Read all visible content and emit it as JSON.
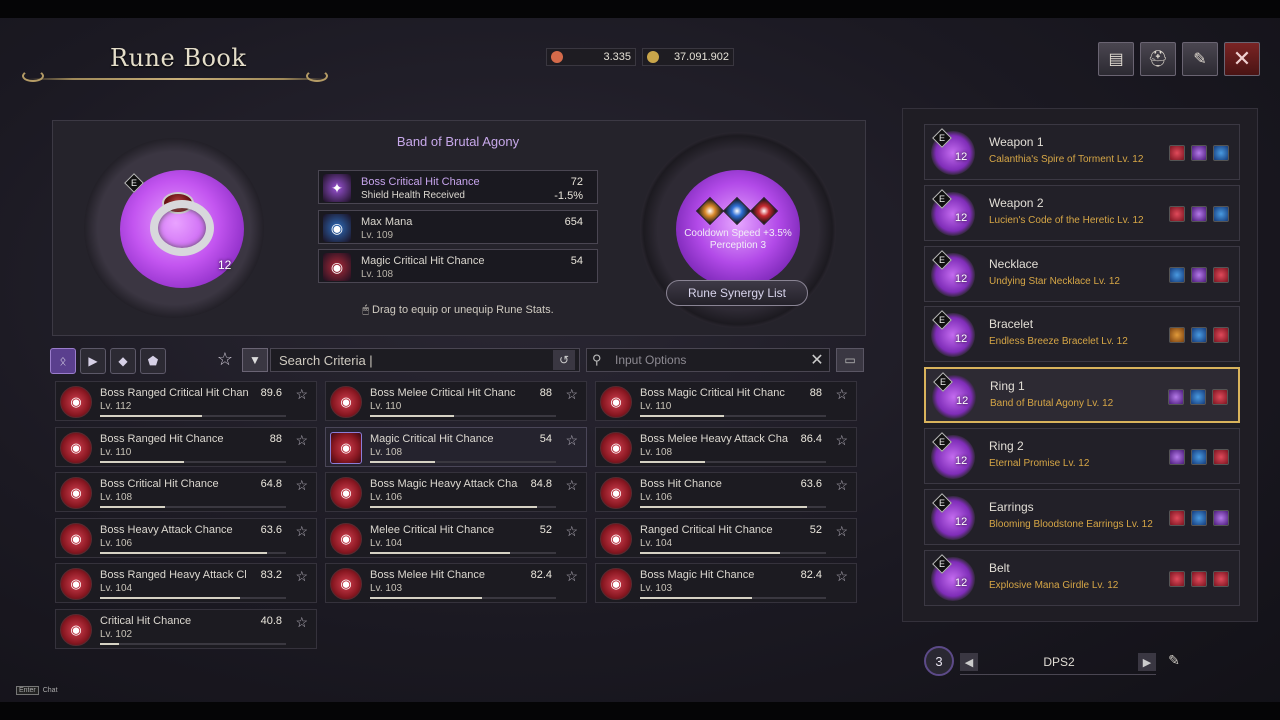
{
  "title": "Rune Book",
  "currency": [
    {
      "value": "3.335",
      "icon": "quill-icon",
      "color": "#d46a4a"
    },
    {
      "value": "37.091.902",
      "icon": "gold-coin-icon",
      "color": "#c9a54a"
    }
  ],
  "top_buttons": [
    {
      "name": "card-icon",
      "glyph": "▤"
    },
    {
      "name": "helmet-icon",
      "glyph": "⛑"
    },
    {
      "name": "scroll-icon",
      "glyph": "✎"
    },
    {
      "name": "close-icon",
      "glyph": "✕"
    }
  ],
  "item": {
    "name": "Band of Brutal Agony",
    "level": "12",
    "grade_badge": "E"
  },
  "equipped_stats": [
    {
      "name": "Boss Critical Hit Chance",
      "value": "72",
      "sub": "Shield Health Received",
      "sub_value": "-1.5%",
      "icon": "purple-rune-icon",
      "color": "#9a52d6"
    },
    {
      "name": "Max Mana",
      "value": "654",
      "sub": "Lv. 109",
      "icon": "blue-rune-icon",
      "color": "#2f6fc0"
    },
    {
      "name": "Magic Critical Hit Chance",
      "value": "54",
      "sub": "Lv. 108",
      "icon": "red-rune-icon",
      "color": "#b02a3a"
    }
  ],
  "drag_hint": "Drag to equip or unequip Rune Stats.",
  "synergy": {
    "line1": "Cooldown Speed +3.5%",
    "line2": "Perception 3",
    "button": "Rune Synergy List",
    "gems": [
      "#d9882a",
      "#2f6fd6",
      "#c82a30"
    ]
  },
  "search": {
    "label": "Search Criteria  |",
    "options_placeholder": "Input Options"
  },
  "rune_list": [
    {
      "name": "Boss Ranged Critical Hit Chan",
      "lv": "Lv. 112",
      "value": "89.6",
      "progress": 0.55
    },
    {
      "name": "Boss Melee Critical Hit Chanc",
      "lv": "Lv. 110",
      "value": "88",
      "progress": 0.45
    },
    {
      "name": "Boss Magic Critical Hit Chanc",
      "lv": "Lv. 110",
      "value": "88",
      "progress": 0.45
    },
    {
      "name": "Boss Ranged Hit Chance",
      "lv": "Lv. 110",
      "value": "88",
      "progress": 0.45
    },
    {
      "name": "Magic Critical Hit Chance",
      "lv": "Lv. 108",
      "value": "54",
      "progress": 0.35,
      "equipped": true
    },
    {
      "name": "Boss Melee Heavy Attack Cha",
      "lv": "Lv. 108",
      "value": "86.4",
      "progress": 0.35
    },
    {
      "name": "Boss Critical Hit Chance",
      "lv": "Lv. 108",
      "value": "64.8",
      "progress": 0.35
    },
    {
      "name": "Boss Magic Heavy Attack Cha",
      "lv": "Lv. 106",
      "value": "84.8",
      "progress": 0.9
    },
    {
      "name": "Boss Hit Chance",
      "lv": "Lv. 106",
      "value": "63.6",
      "progress": 0.9
    },
    {
      "name": "Boss Heavy Attack Chance",
      "lv": "Lv. 106",
      "value": "63.6",
      "progress": 0.9
    },
    {
      "name": "Melee Critical Hit Chance",
      "lv": "Lv. 104",
      "value": "52",
      "progress": 0.75
    },
    {
      "name": "Ranged Critical Hit Chance",
      "lv": "Lv. 104",
      "value": "52",
      "progress": 0.75
    },
    {
      "name": "Boss Ranged Heavy Attack Cl",
      "lv": "Lv. 104",
      "value": "83.2",
      "progress": 0.75
    },
    {
      "name": "Boss Melee Hit Chance",
      "lv": "Lv. 103",
      "value": "82.4",
      "progress": 0.6
    },
    {
      "name": "Boss Magic Hit Chance",
      "lv": "Lv. 103",
      "value": "82.4",
      "progress": 0.6
    },
    {
      "name": "Critical Hit Chance",
      "lv": "Lv. 102",
      "value": "40.8",
      "progress": 0.1
    }
  ],
  "equipment": [
    {
      "slot": "Weapon 1",
      "item": "Calanthia's Spire of Torment Lv. 12",
      "lv": "12",
      "runes": [
        "red",
        "purple",
        "blue"
      ]
    },
    {
      "slot": "Weapon 2",
      "item": "Lucien's Code of the Heretic Lv. 12",
      "lv": "12",
      "runes": [
        "red",
        "purple",
        "blue"
      ]
    },
    {
      "slot": "Necklace",
      "item": "Undying Star Necklace Lv. 12",
      "lv": "12",
      "runes": [
        "blue",
        "purple",
        "red"
      ]
    },
    {
      "slot": "Bracelet",
      "item": "Endless Breeze Bracelet Lv. 12",
      "lv": "12",
      "runes": [
        "orange",
        "blue",
        "red"
      ]
    },
    {
      "slot": "Ring 1",
      "item": "Band of Brutal Agony Lv. 12",
      "lv": "12",
      "runes": [
        "purple",
        "blue",
        "red"
      ],
      "selected": true
    },
    {
      "slot": "Ring 2",
      "item": "Eternal Promise Lv. 12",
      "lv": "12",
      "runes": [
        "purple",
        "blue",
        "red"
      ]
    },
    {
      "slot": "Earrings",
      "item": "Blooming Bloodstone Earrings Lv. 12",
      "lv": "12",
      "runes": [
        "red",
        "blue",
        "purple"
      ]
    },
    {
      "slot": "Belt",
      "item": "Explosive Mana Girdle Lv. 12",
      "lv": "12",
      "runes": [
        "red",
        "red",
        "red"
      ]
    }
  ],
  "preset": {
    "number": "3",
    "name": "DPS2"
  },
  "chat": {
    "key": "Enter",
    "label": "Chat"
  }
}
